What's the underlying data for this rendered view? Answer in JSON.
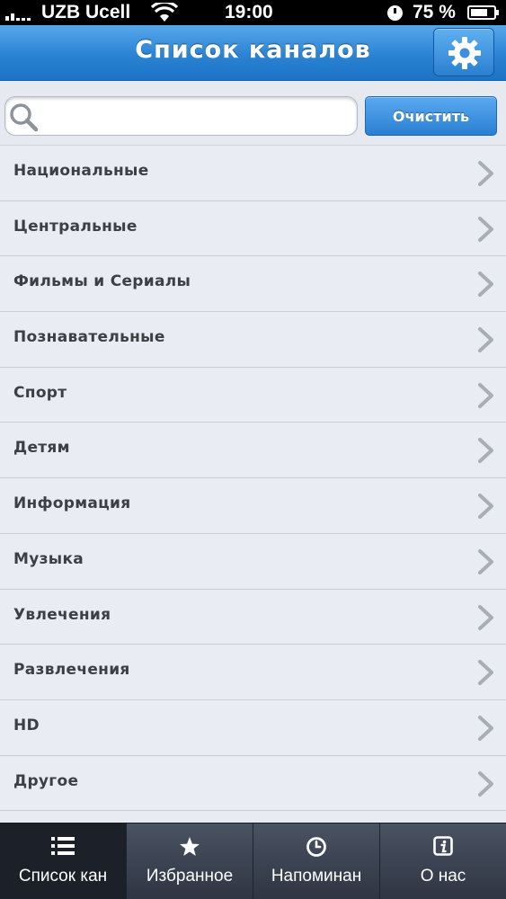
{
  "status_bar": {
    "carrier": "UZB Ucell",
    "time": "19:00",
    "battery": "75 %",
    "battery_level": 0.75
  },
  "header": {
    "title": "Список каналов",
    "settings_icon": "gear-icon"
  },
  "search": {
    "value": "",
    "placeholder": "",
    "clear_label": "Очистить"
  },
  "categories": [
    {
      "label": "Национальные"
    },
    {
      "label": "Центральные"
    },
    {
      "label": "Фильмы и Сериалы"
    },
    {
      "label": "Познавательные"
    },
    {
      "label": "Спорт"
    },
    {
      "label": "Детям"
    },
    {
      "label": "Информация"
    },
    {
      "label": "Музыка"
    },
    {
      "label": "Увлечения"
    },
    {
      "label": "Развлечения"
    },
    {
      "label": "HD"
    },
    {
      "label": "Другое"
    }
  ],
  "tabs": [
    {
      "label": "Список кан",
      "icon": "list-icon",
      "active": true
    },
    {
      "label": "Избранное",
      "icon": "star-icon",
      "active": false
    },
    {
      "label": "Напоминан",
      "icon": "clock-icon",
      "active": false
    },
    {
      "label": "О нас",
      "icon": "info-icon",
      "active": false
    }
  ],
  "colors": {
    "accent": "#2b83d4",
    "tab_bar": "#2f3542",
    "list_bg": "#e9edf3"
  }
}
